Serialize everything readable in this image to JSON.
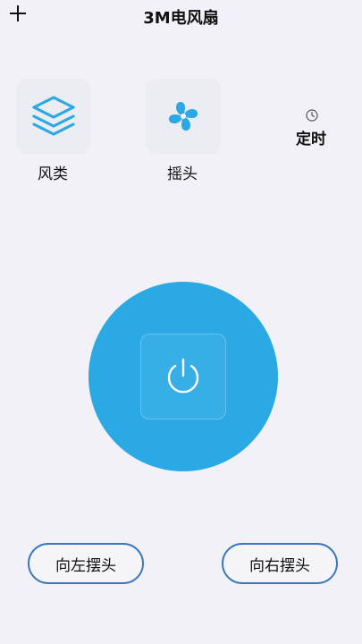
{
  "header": {
    "title": "3M电风扇"
  },
  "functions": {
    "wind_type": {
      "label": "风类",
      "icon": "layers-icon"
    },
    "swing": {
      "label": "摇头",
      "icon": "fan-icon"
    },
    "timer": {
      "label": "定时",
      "icon": "clock-icon"
    }
  },
  "power": {
    "icon": "power-icon"
  },
  "controls": {
    "swing_left": "向左摆头",
    "swing_right": "向右摆头"
  },
  "colors": {
    "accent": "#2ba9e5",
    "pill_border": "#3a78bd",
    "background": "#f1f1f7"
  }
}
